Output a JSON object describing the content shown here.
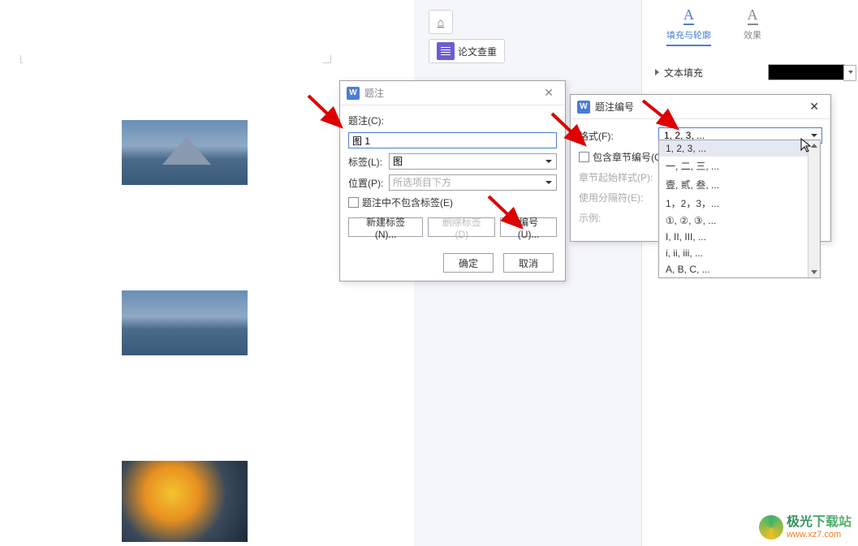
{
  "toolbar": {
    "thesis_check_label": "论文查重"
  },
  "right_panel": {
    "tabs": {
      "fill_outline": "填充与轮廓",
      "effects": "效果"
    },
    "text_fill_label": "文本填充",
    "fill_color": "#000000"
  },
  "dialog_caption": {
    "title": "题注",
    "caption_label": "题注(C):",
    "caption_value": "图 1",
    "tag_label": "标签(L):",
    "tag_value": "图",
    "position_label": "位置(P):",
    "position_value": "所选项目下方",
    "exclude_label": "题注中不包含标签(E)",
    "new_tag_btn": "新建标签(N)...",
    "delete_tag_btn": "删除标签(D)",
    "numbering_btn": "编号(U)...",
    "ok_btn": "确定",
    "cancel_btn": "取消"
  },
  "dialog_numbering": {
    "title": "题注编号",
    "format_label": "格式(F):",
    "format_value": "1, 2, 3, ...",
    "include_chapter_label": "包含章节编号(C)",
    "chapter_style_label": "章节起始样式(P):",
    "separator_label": "使用分隔符(E):",
    "example_label": "示例:"
  },
  "dropdown_options": [
    "1, 2, 3, ...",
    "一, 二, 三, ...",
    "壹, 贰, 叁, ...",
    "1，2，3，...",
    "①, ②, ③, ...",
    "I, II, III, ...",
    "i, ii, iii, ...",
    "A, B, C, ..."
  ],
  "watermark": {
    "name": "极光下载站",
    "url": "www.xz7.com"
  }
}
